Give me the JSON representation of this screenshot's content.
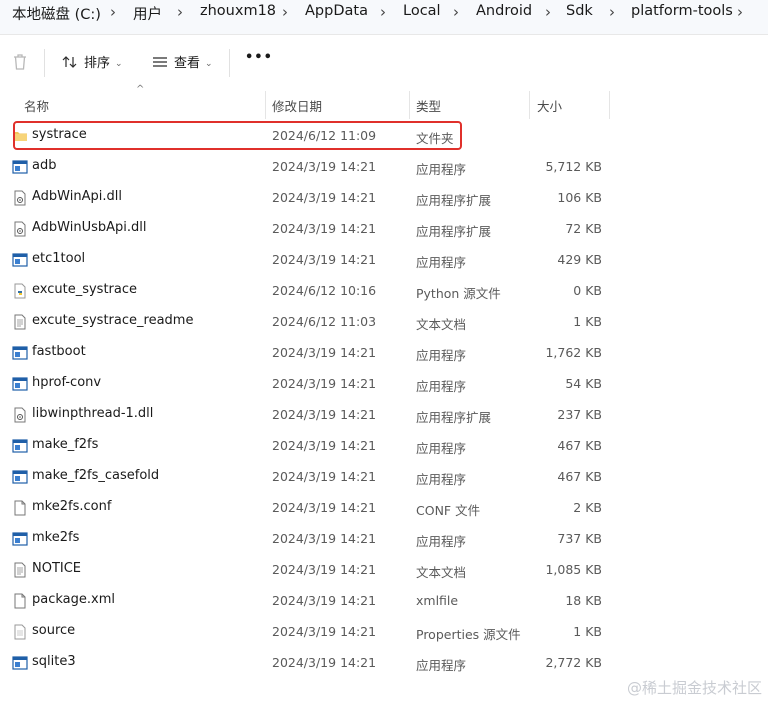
{
  "breadcrumb": [
    "本地磁盘 (C:)",
    "用户",
    "zhouxm18",
    "AppData",
    "Local",
    "Android",
    "Sdk",
    "platform-tools"
  ],
  "toolbar": {
    "sort_label": "排序",
    "view_label": "查看",
    "more_label": "•••"
  },
  "columns": {
    "name": "名称",
    "date": "修改日期",
    "type": "类型",
    "size": "大小"
  },
  "rows": [
    {
      "name": "systrace",
      "date": "2024/6/12 11:09",
      "type": "文件夹",
      "size": "",
      "icon": "folder-icon"
    },
    {
      "name": "adb",
      "date": "2024/3/19 14:21",
      "type": "应用程序",
      "size": "5,712 KB",
      "icon": "app-icon"
    },
    {
      "name": "AdbWinApi.dll",
      "date": "2024/3/19 14:21",
      "type": "应用程序扩展",
      "size": "106 KB",
      "icon": "dll-icon"
    },
    {
      "name": "AdbWinUsbApi.dll",
      "date": "2024/3/19 14:21",
      "type": "应用程序扩展",
      "size": "72 KB",
      "icon": "dll-icon"
    },
    {
      "name": "etc1tool",
      "date": "2024/3/19 14:21",
      "type": "应用程序",
      "size": "429 KB",
      "icon": "app-icon"
    },
    {
      "name": "excute_systrace",
      "date": "2024/6/12 10:16",
      "type": "Python 源文件",
      "size": "0 KB",
      "icon": "python-file-icon"
    },
    {
      "name": "excute_systrace_readme",
      "date": "2024/6/12 11:03",
      "type": "文本文档",
      "size": "1 KB",
      "icon": "text-file-icon"
    },
    {
      "name": "fastboot",
      "date": "2024/3/19 14:21",
      "type": "应用程序",
      "size": "1,762 KB",
      "icon": "app-icon"
    },
    {
      "name": "hprof-conv",
      "date": "2024/3/19 14:21",
      "type": "应用程序",
      "size": "54 KB",
      "icon": "app-icon"
    },
    {
      "name": "libwinpthread-1.dll",
      "date": "2024/3/19 14:21",
      "type": "应用程序扩展",
      "size": "237 KB",
      "icon": "dll-icon"
    },
    {
      "name": "make_f2fs",
      "date": "2024/3/19 14:21",
      "type": "应用程序",
      "size": "467 KB",
      "icon": "app-icon"
    },
    {
      "name": "make_f2fs_casefold",
      "date": "2024/3/19 14:21",
      "type": "应用程序",
      "size": "467 KB",
      "icon": "app-icon"
    },
    {
      "name": "mke2fs.conf",
      "date": "2024/3/19 14:21",
      "type": "CONF 文件",
      "size": "2 KB",
      "icon": "blank-file-icon"
    },
    {
      "name": "mke2fs",
      "date": "2024/3/19 14:21",
      "type": "应用程序",
      "size": "737 KB",
      "icon": "app-icon"
    },
    {
      "name": "NOTICE",
      "date": "2024/3/19 14:21",
      "type": "文本文档",
      "size": "1,085 KB",
      "icon": "text-file-icon"
    },
    {
      "name": "package.xml",
      "date": "2024/3/19 14:21",
      "type": "xmlfile",
      "size": "18 KB",
      "icon": "blank-file-icon"
    },
    {
      "name": "source",
      "date": "2024/3/19 14:21",
      "type": "Properties 源文件",
      "size": "1 KB",
      "icon": "properties-file-icon"
    },
    {
      "name": "sqlite3",
      "date": "2024/3/19 14:21",
      "type": "应用程序",
      "size": "2,772 KB",
      "icon": "app-icon"
    }
  ],
  "watermark": "@稀土掘金技术社区",
  "colors": {
    "highlight": "#e0302b",
    "folder": "#f2c55c",
    "app_blue": "#1f5fa8"
  }
}
